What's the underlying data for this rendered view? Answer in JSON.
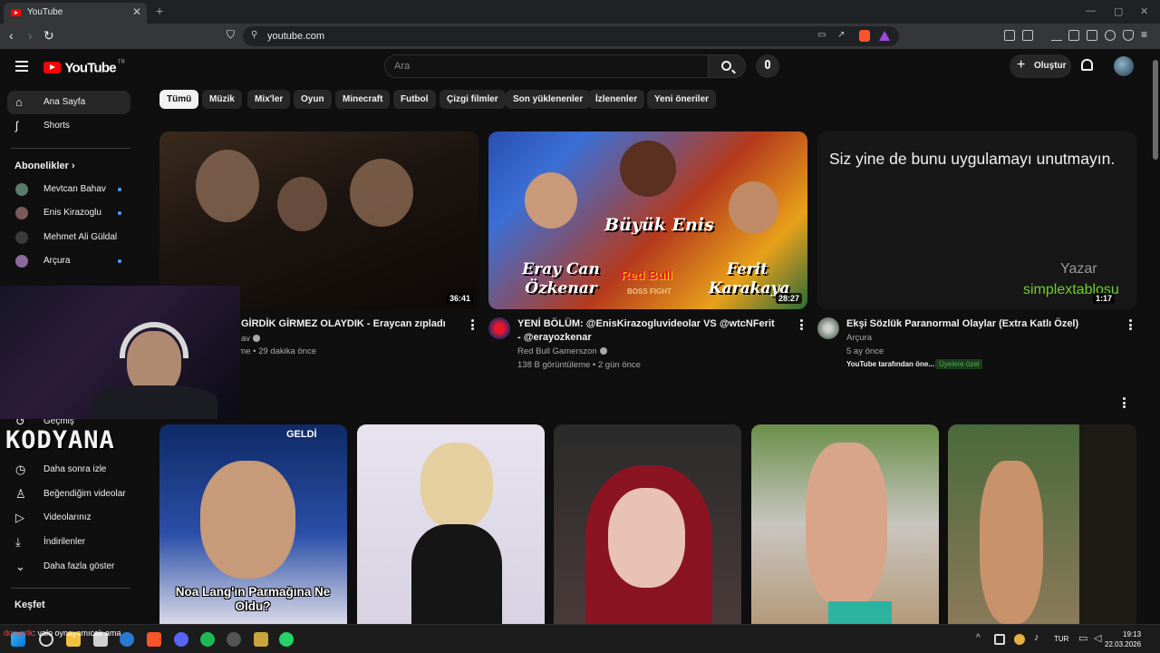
{
  "browser": {
    "tab_title": "YouTube",
    "url": "youtube.com"
  },
  "header": {
    "logo_text": "YouTube",
    "country_code": "TR",
    "search_placeholder": "Ara",
    "create_label": "Oluştur"
  },
  "sidebar": {
    "main": [
      {
        "label": "Ana Sayfa",
        "icon": "home-icon"
      },
      {
        "label": "Shorts",
        "icon": "shorts-icon"
      }
    ],
    "subscriptions_heading": "Abonelikler",
    "subscriptions": [
      {
        "label": "Mevtcan Bahav",
        "color": "#5a7a6a"
      },
      {
        "label": "Enis Kirazoglu",
        "color": "#7a5a5a"
      },
      {
        "label": "Mehmet Ali Güldal",
        "color": "#3a3a3a"
      },
      {
        "label": "Arçura",
        "color": "#8a6a9a"
      }
    ],
    "you_items": [
      {
        "label": "Geçmiş",
        "icon": "history-icon"
      },
      {
        "label": "Daha sonra izle",
        "icon": "clock-icon"
      },
      {
        "label": "Beğendiğim videolar",
        "icon": "thumbs-up-icon"
      },
      {
        "label": "Videolarınız",
        "icon": "video-icon"
      },
      {
        "label": "İndirilenler",
        "icon": "download-icon"
      },
      {
        "label": "Daha fazla göster",
        "icon": "chevron-down-icon"
      }
    ],
    "explore_heading": "Keşfet"
  },
  "chips": [
    "Tümü",
    "Müzik",
    "Mix'ler",
    "Oyun",
    "Minecraft",
    "Futbol",
    "Çizgi filmler",
    "Son yüklenenler",
    "İzlenenler",
    "Yeni öneriler"
  ],
  "videos": [
    {
      "title": "GİRDİK GİRMEZ OLAYDIK - Eraycan zıpladı",
      "channel": "av",
      "meta": "eme • 29 dakika önce",
      "duration": "36:41"
    },
    {
      "title": "YENİ BÖLÜM: @EnisKirazogluvideolar VS @wtcNFerit - @erayozkenar",
      "channel": "Red Bull Gamerszon",
      "meta": "138 B görüntüleme • 2 gün önce",
      "duration": "28:27",
      "thumb_text": {
        "top": "Büyük Enis",
        "left": "Eray Can Özkenar",
        "right": "Ferit Karakaya",
        "brand": "Red Bull",
        "sub": "BOSS FIGHT"
      }
    },
    {
      "title": "Ekşi Sözlük Paranormal Olaylar (Extra Katlı Özel)",
      "channel": "Arçura",
      "meta": "5 ay önce",
      "duration": "1:17",
      "badge_left": "YouTube tarafından öne...",
      "badge_members": "Üyelere özel",
      "thumb_text": {
        "headline": "Siz yine de bunu uygulamayı unutmayın.",
        "author_label": "Yazar",
        "author": "simplextablosu"
      }
    }
  ],
  "shorts": [
    {
      "overlay": "Noa Lang'ın Parmağına Ne Oldu?",
      "brand": "GELDİ"
    },
    {
      "overlay": ""
    },
    {
      "overlay": ""
    },
    {
      "overlay": ""
    },
    {
      "overlay": ""
    }
  ],
  "overlay": {
    "streamer_name": "KODYANA",
    "chat_nick": "dorugrlk",
    "chat_message": ": valo oynayamıcak ama"
  },
  "taskbar": {
    "lang": "TUR",
    "time": "19:13",
    "date": "22.03.2026"
  }
}
